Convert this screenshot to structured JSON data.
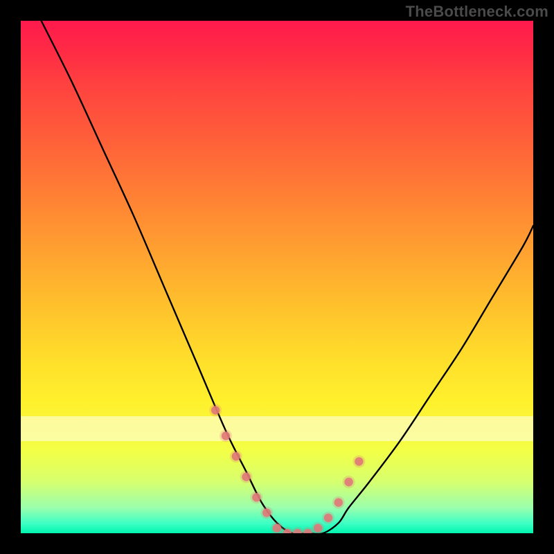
{
  "watermark": "TheBottleneck.com",
  "chart_data": {
    "type": "line",
    "title": "",
    "xlabel": "",
    "ylabel": "",
    "xlim": [
      0,
      100
    ],
    "ylim": [
      0,
      100
    ],
    "grid": false,
    "legend_position": "none",
    "series": [
      {
        "name": "bottleneck-curve",
        "color": "#000000",
        "x": [
          4,
          10,
          16,
          22,
          28,
          34,
          40,
          44,
          47,
          50,
          53,
          56,
          59,
          62,
          64,
          68,
          74,
          80,
          86,
          92,
          98,
          100
        ],
        "y": [
          100,
          88,
          75,
          62,
          48,
          34,
          20,
          12,
          6,
          2,
          0,
          0,
          0,
          2,
          5,
          10,
          18,
          27,
          36,
          46,
          56,
          60
        ]
      }
    ],
    "markers": {
      "name": "highlighted-points",
      "type": "scatter",
      "color": "#e07878",
      "x": [
        38,
        40,
        42,
        44,
        46,
        48,
        50,
        52,
        54,
        56,
        58,
        60,
        62,
        64,
        66
      ],
      "y": [
        24,
        19,
        15,
        11,
        7,
        4,
        1,
        0,
        0,
        0,
        1,
        3,
        6,
        10,
        14
      ]
    },
    "gradient_stops": [
      {
        "pct": 0,
        "color": "#ff1a4d"
      },
      {
        "pct": 25,
        "color": "#ff6a38"
      },
      {
        "pct": 50,
        "color": "#ffc22c"
      },
      {
        "pct": 75,
        "color": "#fff02c"
      },
      {
        "pct": 100,
        "color": "#00f5b0"
      }
    ]
  }
}
